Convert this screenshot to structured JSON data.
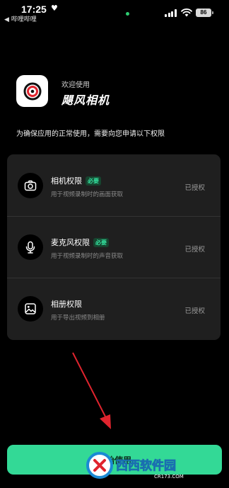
{
  "status_bar": {
    "time": "17:25",
    "heart_icon": "heart-icon",
    "back_app": "◀ 哔哩哔哩",
    "battery": "86"
  },
  "header": {
    "logo_icon": "camera-lens-icon",
    "welcome": "欢迎使用",
    "app_name": "飓风相机",
    "intro": "为确保应用的正常使用，需要向您申请以下权限"
  },
  "permissions": [
    {
      "icon": "camera-icon",
      "title": "相机权限",
      "badge": "必要",
      "description": "用于视频录制时的画面获取",
      "status": "已授权"
    },
    {
      "icon": "microphone-icon",
      "title": "麦克风权限",
      "badge": "必要",
      "description": "用于视频录制时的声音获取",
      "status": "已授权"
    },
    {
      "icon": "photo-album-icon",
      "title": "相册权限",
      "badge": "",
      "description": "用于导出视频到相册",
      "status": "已授权"
    }
  ],
  "primary_button": {
    "label": "开始使用"
  },
  "watermark": {
    "text": "西西软件园",
    "url": "CR173.COM"
  },
  "colors": {
    "accent": "#33d996",
    "background": "#000000",
    "card": "#1f1f1f",
    "annotation_arrow": "#e0242e"
  }
}
